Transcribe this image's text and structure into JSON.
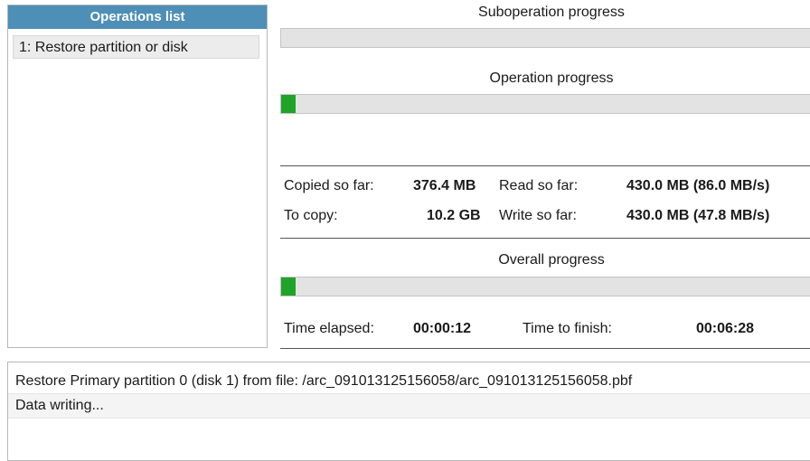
{
  "operations": {
    "header": "Operations list",
    "items": [
      {
        "label": "1: Restore partition or disk"
      }
    ]
  },
  "suboperation": {
    "label": "Suboperation progress",
    "progress": 0
  },
  "operation": {
    "label": "Operation progress",
    "progress": 0.026
  },
  "stats": {
    "copied_label": "Copied so far:",
    "copied_value": "376.4 MB",
    "read_label": "Read so far:",
    "read_value": "430.0 MB (86.0 MB/s)",
    "to_copy_label": "To copy:",
    "to_copy_value": "10.2 GB",
    "write_label": "Write so far:",
    "write_value": "430.0 MB (47.8 MB/s)"
  },
  "overall": {
    "label": "Overall progress",
    "progress": 0.026
  },
  "time": {
    "elapsed_label": "Time elapsed:",
    "elapsed_value": "00:00:12",
    "finish_label": "Time to finish:",
    "finish_value": "00:06:28"
  },
  "log": {
    "lines": [
      "Restore Primary partition 0 (disk 1) from file: /arc_091013125156058/arc_091013125156058.pbf",
      "Data writing..."
    ]
  },
  "colors": {
    "header_bg": "#4d8fb7",
    "progress_fill": "#1fa328"
  }
}
